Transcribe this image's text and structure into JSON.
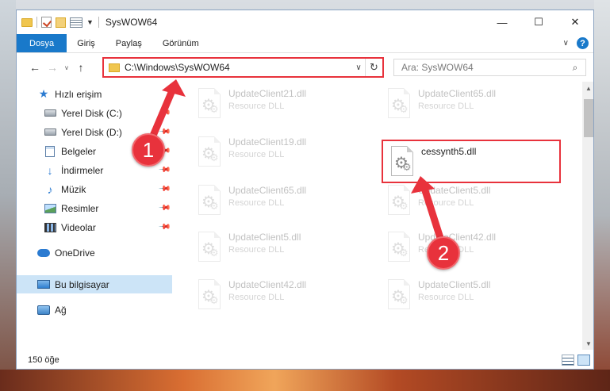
{
  "window": {
    "title": "SysWOW64",
    "controls": {
      "minimize": "—",
      "maximize": "☐",
      "close": "✕"
    }
  },
  "ribbon": {
    "tabs": [
      "Dosya",
      "Giriş",
      "Paylaş",
      "Görünüm"
    ],
    "help": "?"
  },
  "navigation": {
    "back": "←",
    "forward": "→",
    "recent": "v",
    "up": "↑",
    "address": "C:\\Windows\\SysWOW64",
    "search_placeholder": "Ara: SysWOW64"
  },
  "sidebar": {
    "items": [
      {
        "label": "Hızlı erişim",
        "icon": "star-icon"
      },
      {
        "label": "Yerel Disk (C:)",
        "icon": "drive-icon",
        "pinned": true
      },
      {
        "label": "Yerel Disk (D:)",
        "icon": "drive-icon",
        "pinned": true
      },
      {
        "label": "Belgeler",
        "icon": "documents-icon",
        "pinned": true
      },
      {
        "label": "İndirmeler",
        "icon": "downloads-icon",
        "pinned": true
      },
      {
        "label": "Müzik",
        "icon": "music-icon",
        "pinned": true
      },
      {
        "label": "Resimler",
        "icon": "pictures-icon",
        "pinned": true
      },
      {
        "label": "Videolar",
        "icon": "videos-icon",
        "pinned": true
      },
      {
        "label": "OneDrive",
        "icon": "cloud-icon"
      },
      {
        "label": "Bu bilgisayar",
        "icon": "computer-icon",
        "selected": true
      },
      {
        "label": "Ağ",
        "icon": "network-icon"
      }
    ]
  },
  "files": [
    {
      "name": "UpdateClient21.dll",
      "desc": "Resource DLL",
      "faded": true
    },
    {
      "name": "UpdateClient65.dll",
      "desc": "Resource DLL",
      "faded": true
    },
    {
      "name": "UpdateClient19.dll",
      "desc": "Resource DLL",
      "faded": true
    },
    {
      "name": "cessynth5.dll",
      "desc": "",
      "highlighted": true
    },
    {
      "name": "UpdateClient65.dll",
      "desc": "Resource DLL",
      "faded": true
    },
    {
      "name": "UpdateClient5.dll",
      "desc": "Resource DLL",
      "faded": true
    },
    {
      "name": "UpdateClient5.dll",
      "desc": "Resource DLL",
      "faded": true
    },
    {
      "name": "UpdateClient42.dll",
      "desc": "Resource DLL",
      "faded": true
    },
    {
      "name": "UpdateClient42.dll",
      "desc": "Resource DLL",
      "faded": true
    },
    {
      "name": "UpdateClient5.dll",
      "desc": "Resource DLL",
      "faded": true
    }
  ],
  "status": {
    "item_count": "150 öğe"
  },
  "callouts": {
    "first": "1",
    "second": "2"
  },
  "colors": {
    "accent": "#1979ca",
    "highlight": "#e8323c",
    "selection": "#cce4f7"
  }
}
